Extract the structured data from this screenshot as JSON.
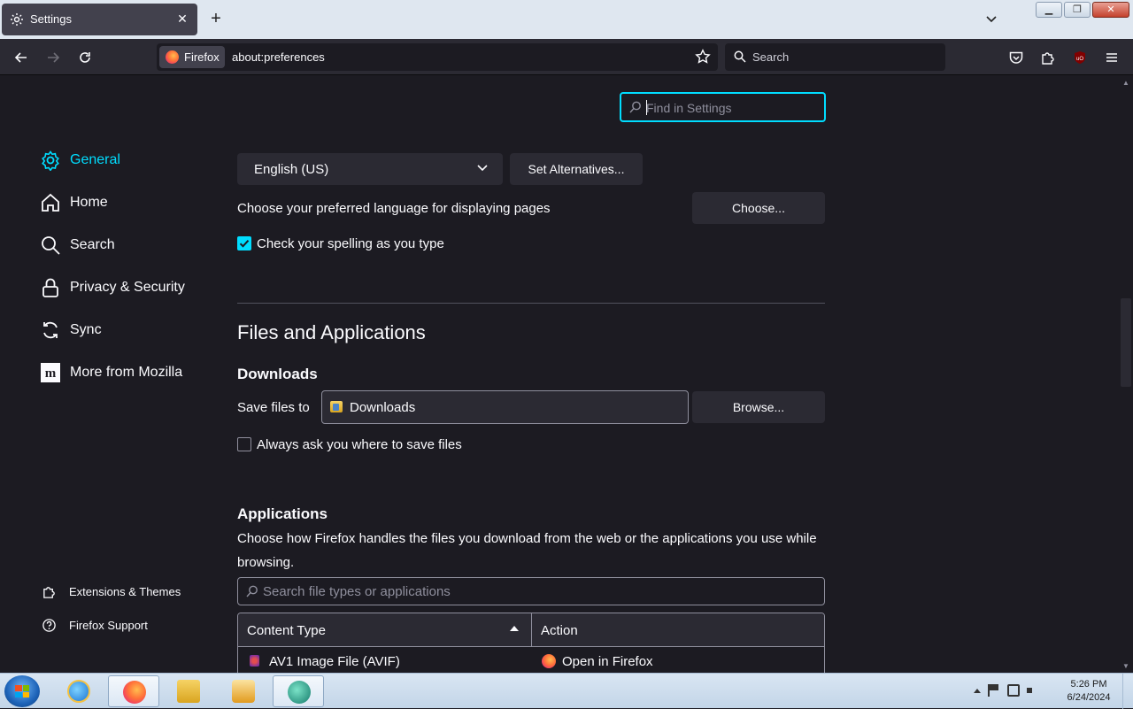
{
  "tab": {
    "title": "Settings",
    "close_glyph": "✕",
    "new_tab_glyph": "+"
  },
  "window_buttons": {
    "minimize": "▁",
    "restore": "❐",
    "close": "✕"
  },
  "navbar": {
    "identity_label": "Firefox",
    "url": "about:preferences",
    "search_placeholder": "Search"
  },
  "find_settings": {
    "placeholder": "Find in Settings"
  },
  "sidebar": {
    "items": [
      {
        "label": "General",
        "icon": "gear-icon",
        "active": true
      },
      {
        "label": "Home",
        "icon": "home-icon"
      },
      {
        "label": "Search",
        "icon": "search-icon"
      },
      {
        "label": "Privacy & Security",
        "icon": "lock-icon"
      },
      {
        "label": "Sync",
        "icon": "sync-icon"
      },
      {
        "label": "More from Mozilla",
        "icon": "mozilla-icon"
      }
    ],
    "footer": [
      {
        "label": "Extensions & Themes",
        "icon": "puzzle-icon"
      },
      {
        "label": "Firefox Support",
        "icon": "help-icon"
      }
    ]
  },
  "language": {
    "selected": "English (US)",
    "set_alternatives_label": "Set Alternatives...",
    "preferred_text": "Choose your preferred language for displaying pages",
    "choose_label": "Choose...",
    "spellcheck_label": "Check your spelling as you type",
    "spellcheck_checked": true
  },
  "files": {
    "heading": "Files and Applications",
    "downloads_heading": "Downloads",
    "save_files_label": "Save files to",
    "save_folder": "Downloads",
    "browse_label": "Browse...",
    "always_ask_label": "Always ask you where to save files",
    "always_ask_checked": false
  },
  "applications": {
    "heading": "Applications",
    "description_line1": "Choose how Firefox handles the files you download from the web or the applications you use while",
    "description_line2": "browsing.",
    "search_placeholder": "Search file types or applications",
    "columns": [
      "Content Type",
      "Action"
    ],
    "rows": [
      {
        "content_type": "AV1 Image File (AVIF)",
        "action": "Open in Firefox"
      }
    ]
  },
  "taskbar": {
    "clock_time": "5:26 PM",
    "clock_date": "6/24/2024"
  },
  "colors": {
    "accent": "#00ddff",
    "background": "#1c1b22",
    "surface": "#2b2a33"
  }
}
